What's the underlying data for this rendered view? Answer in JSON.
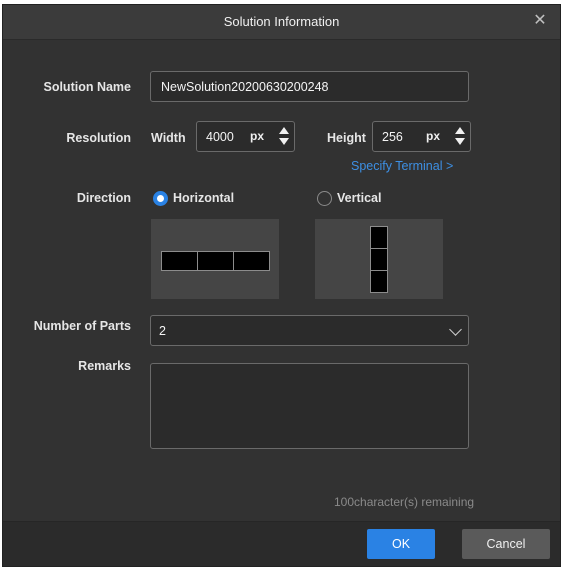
{
  "dialog": {
    "title": "Solution Information",
    "close_icon": "close-icon"
  },
  "solution_name": {
    "label": "Solution Name",
    "value": "NewSolution20200630200248"
  },
  "resolution": {
    "label": "Resolution",
    "width_label": "Width",
    "width_value": "4000",
    "width_unit": "px",
    "height_label": "Height",
    "height_value": "256",
    "height_unit": "px",
    "specify_terminal": "Specify Terminal >"
  },
  "direction": {
    "label": "Direction",
    "options": [
      {
        "label": "Horizontal",
        "selected": true
      },
      {
        "label": "Vertical",
        "selected": false
      }
    ]
  },
  "number_of_parts": {
    "label": "Number of Parts",
    "value": "2"
  },
  "remarks": {
    "label": "Remarks",
    "value": "",
    "remaining": "100character(s) remaining"
  },
  "footer": {
    "ok_label": "OK",
    "cancel_label": "Cancel"
  },
  "colors": {
    "accent": "#2a82e4",
    "link": "#3d8fe3",
    "background": "#323232"
  }
}
